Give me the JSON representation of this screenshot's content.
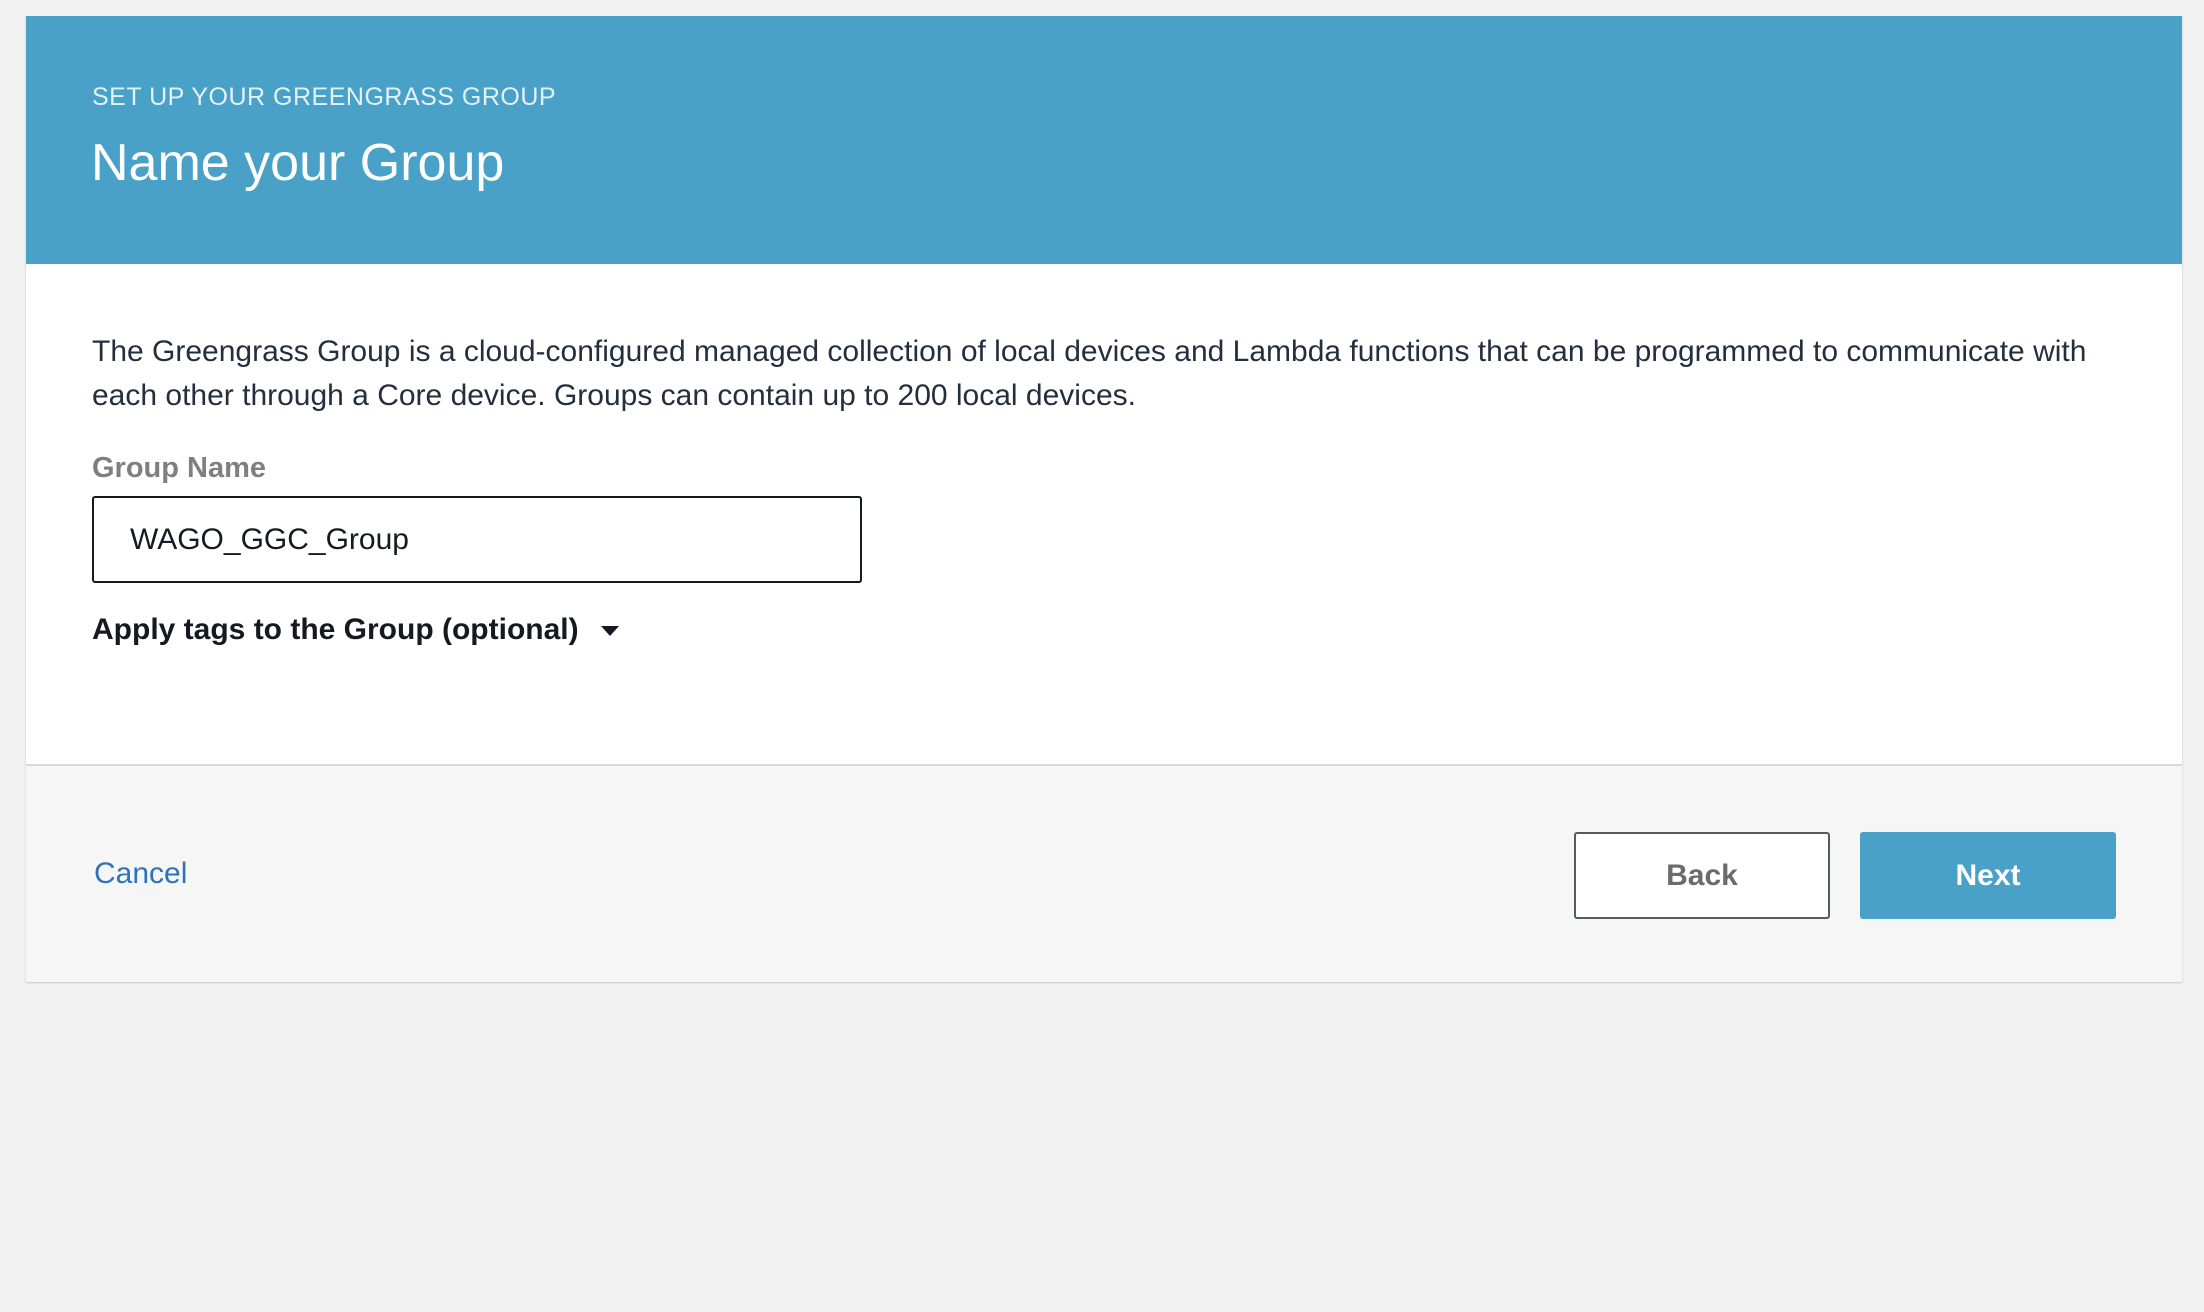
{
  "header": {
    "eyebrow": "SET UP YOUR GREENGRASS GROUP",
    "title": "Name your Group",
    "background_color": "#4aa1c8"
  },
  "body": {
    "description": "The Greengrass Group is a cloud-configured managed collection of local devices and Lambda functions that can be programmed to communicate with each other through a Core device. Groups can contain up to 200 local devices.",
    "group_name_label": "Group Name",
    "group_name_value": "WAGO_GGC_Group",
    "tags_toggle_label": "Apply tags to the Group (optional)",
    "tags_toggle_icon": "caret-down-icon"
  },
  "footer": {
    "cancel_label": "Cancel",
    "back_label": "Back",
    "next_label": "Next",
    "link_color": "#2e73b8",
    "primary_color": "#4aa1c8"
  }
}
